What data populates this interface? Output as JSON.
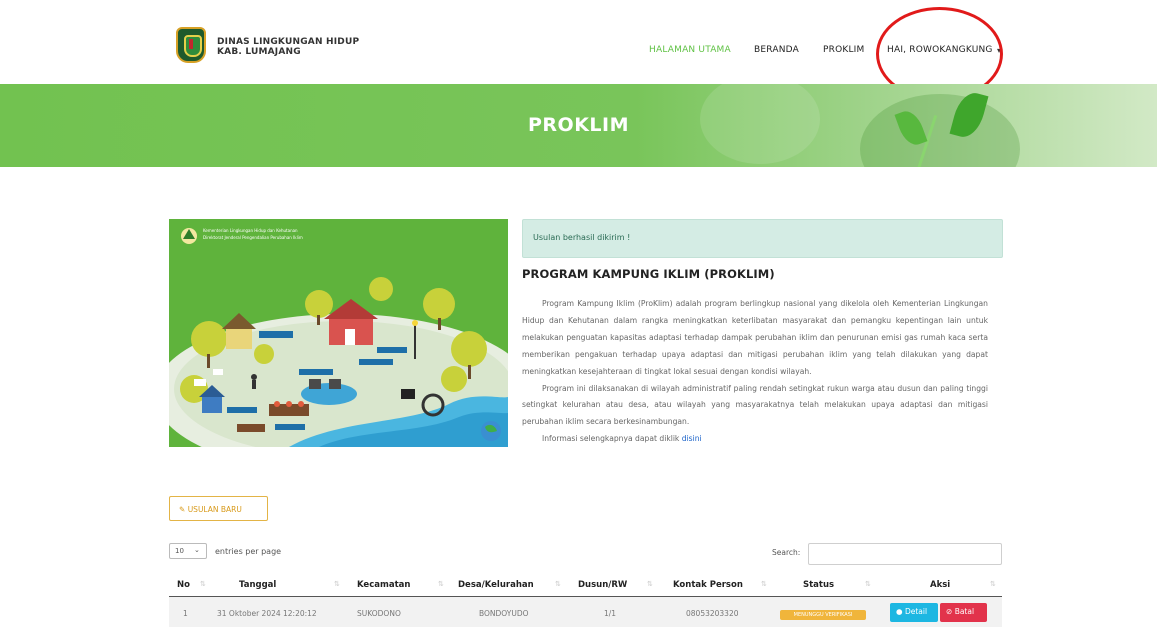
{
  "header": {
    "brand_line1": "DINAS LINGKUNGAN HIDUP",
    "brand_line2": "KAB. LUMAJANG",
    "nav": {
      "halaman_utama": "HALAMAN UTAMA",
      "beranda": "BERANDA",
      "proklim": "PROKLIM",
      "user_menu": "HAI, ROWOKANGKUNG"
    },
    "active_color": "#60c245",
    "annotation_color": "#e11a1a"
  },
  "banner": {
    "title": "PROKLIM",
    "color": "#72c250"
  },
  "illustration": {
    "caption_line1": "Kementerian Lingkungan Hidup dan Kehutanan",
    "caption_line2": "Direktorat Jenderal Pengendalian Perubahan Iklim"
  },
  "alert": {
    "text": "Usulan berhasil dikirim !"
  },
  "program": {
    "title": "PROGRAM KAMPUNG IKLIM (PROKLIM)",
    "paragraph1": "Program Kampung Iklim (ProKlim) adalah program berlingkup nasional yang dikelola oleh Kementerian Lingkungan Hidup dan Kehutanan dalam rangka meningkatkan keterlibatan masyarakat dan pemangku kepentingan lain untuk melakukan penguatan kapasitas adaptasi terhadap dampak perubahan iklim dan penurunan emisi gas rumah kaca serta memberikan pengakuan terhadap upaya adaptasi dan mitigasi perubahan iklim yang telah dilakukan yang dapat meningkatkan kesejahteraan di tingkat lokal sesuai dengan kondisi wilayah.",
    "paragraph2": "Program ini dilaksanakan di wilayah administratif paling rendah setingkat rukun warga atau dusun dan paling tinggi setingkat kelurahan atau desa, atau wilayah yang masyarakatnya telah melakukan upaya adaptasi dan mitigasi perubahan iklim secara berkesinambungan.",
    "paragraph3_prefix": "Informasi selengkapnya dapat diklik ",
    "paragraph3_link": "disini"
  },
  "new_button": {
    "icon": "edit-icon",
    "label": "USULAN BARU"
  },
  "datatable": {
    "length_value": "10",
    "length_text": "entries per page",
    "search_label": "Search:",
    "search_value": "",
    "columns": [
      "No",
      "Tanggal",
      "Kecamatan",
      "Desa/Kelurahan",
      "Dusun/RW",
      "Kontak Person",
      "Status",
      "Aksi"
    ],
    "rows": [
      {
        "no": "1",
        "tanggal": "31 Oktober 2024 12:20:12",
        "kecamatan": "SUKODONO",
        "desa": "BONDOYUDO",
        "dusun": "1/1",
        "kontak": "08053203320",
        "status": "MENUNGGU VERIFIKASI",
        "status_color": "#f0b53b",
        "detail_label": "Detail",
        "batal_label": "Batal"
      }
    ]
  }
}
